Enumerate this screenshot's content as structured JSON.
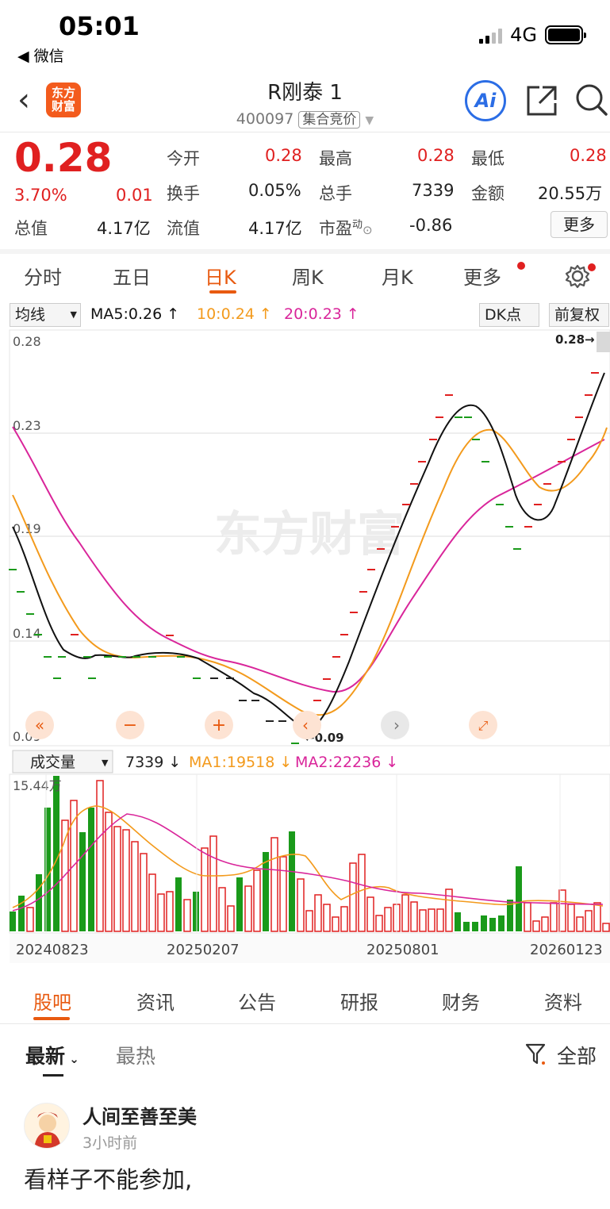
{
  "status": {
    "time": "05:01",
    "back_app": "◀ 微信",
    "network": "4G"
  },
  "nav": {
    "title": "R刚泰 1",
    "code": "400097",
    "auction_tag": "集合竞价",
    "logo_text": "东方财富",
    "ai_label": "Ai"
  },
  "quote": {
    "price": "0.28",
    "change_pct": "3.70%",
    "change": "0.01",
    "open_label": "今开",
    "open": "0.28",
    "high_label": "最高",
    "high": "0.28",
    "low_label": "最低",
    "low": "0.28",
    "turnover_label": "换手",
    "turnover": "0.05%",
    "volume_label": "总手",
    "volume": "7339",
    "amount_label": "金额",
    "amount": "20.55万",
    "total_value_label": "总值",
    "total_value": "4.17亿",
    "float_value_label": "流值",
    "float_value": "4.17亿",
    "pe_label": "市盈",
    "pe_sup": "动",
    "pe": "-0.86",
    "more_label": "更多"
  },
  "period_tabs": [
    "分时",
    "五日",
    "日K",
    "周K",
    "月K",
    "更多"
  ],
  "active_period": "日K",
  "ma_bar": {
    "selector": "均线",
    "ma5": "MA5:0.26",
    "ma10": "10:0.24",
    "ma20": "20:0.23",
    "dk": "DK点",
    "adjust": "前复权"
  },
  "price_axis": [
    "0.28",
    "0.23",
    "0.19",
    "0.14",
    "0.09"
  ],
  "max_marker": "0.28",
  "min_marker": "0.09",
  "watermark": "东方财富",
  "vol_bar": {
    "selector": "成交量",
    "vol": "7339",
    "ma1": "MA1:19518",
    "ma2": "MA2:22236",
    "max": "15.44万"
  },
  "date_axis": [
    "20240823",
    "20250207",
    "20250801",
    "20260123"
  ],
  "colors": {
    "up": "#e02020",
    "down": "#1a9a1a",
    "ma5": "#111111",
    "ma10": "#f39a1c",
    "ma20": "#d9259a",
    "accent": "#e85a10"
  },
  "bottom_tabs": [
    "股吧",
    "资讯",
    "公告",
    "研报",
    "财务",
    "资料"
  ],
  "sort": {
    "latest": "最新",
    "hot": "最热",
    "filter": "全部"
  },
  "post": {
    "user": "人间至善至美",
    "time": "3小时前",
    "text": "看样子不能参加,"
  }
}
